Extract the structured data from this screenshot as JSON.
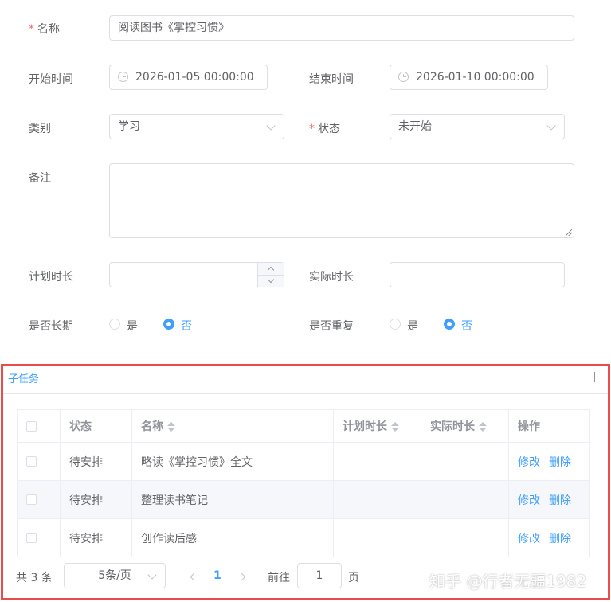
{
  "form": {
    "name_label": "名称",
    "name_value": "阅读图书《掌控习惯》",
    "start_label": "开始时间",
    "start_value": "2026-01-05 00:00:00",
    "end_label": "结束时间",
    "end_value": "2026-01-10 00:00:00",
    "category_label": "类别",
    "category_value": "学习",
    "status_label": "状态",
    "status_value": "未开始",
    "remark_label": "备注",
    "remark_value": "",
    "planned_label": "计划时长",
    "planned_value": "",
    "actual_label": "实际时长",
    "actual_value": "",
    "long_term_label": "是否长期",
    "repeat_label": "是否重复",
    "yes": "是",
    "no": "否",
    "long_term_selected": "否",
    "repeat_selected": "否"
  },
  "subtasks": {
    "title": "子任务",
    "add_icon": "plus-icon",
    "columns": [
      "状态",
      "名称",
      "计划时长",
      "实际时长",
      "操作"
    ],
    "rows": [
      {
        "status": "待安排",
        "name": "略读《掌控习惯》全文",
        "planned": "",
        "actual": "",
        "edit": "修改",
        "delete": "删除"
      },
      {
        "status": "待安排",
        "name": "整理读书笔记",
        "planned": "",
        "actual": "",
        "edit": "修改",
        "delete": "删除"
      },
      {
        "status": "待安排",
        "name": "创作读后感",
        "planned": "",
        "actual": "",
        "edit": "修改",
        "delete": "删除"
      }
    ]
  },
  "pagination": {
    "total": "共 3 条",
    "page_size": "5条/页",
    "current_page": "1",
    "goto_label": "前往",
    "goto_value": "1",
    "page_unit": "页"
  },
  "watermark": "知乎 @行者无疆1982",
  "colors": {
    "primary": "#409eff",
    "required": "#f56c6c",
    "highlight_border": "#e84c4c"
  }
}
